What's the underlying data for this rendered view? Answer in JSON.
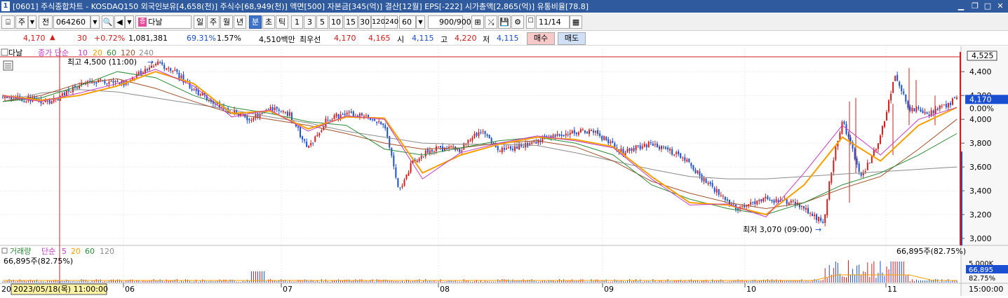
{
  "window": {
    "title_num": "1",
    "title": "[0601] 주식종합차트 - KOSDAQ150 외국인보유[4,658(천)] 주식수[68,949(천)] 액면[500] 자본금[345(억)] 결산[12월] EPS[-222] 시가총액[2,865(억)] 유통비율[78.8]"
  },
  "toolbar": {
    "market": "주",
    "prev_label": "전",
    "code": "064260",
    "badge": "증",
    "name": "다날",
    "periods": [
      "일",
      "주",
      "월",
      "년",
      "분",
      "초",
      "틱"
    ],
    "intervals": [
      "1",
      "3",
      "5",
      "10",
      "15",
      "30",
      "120",
      "240"
    ],
    "interval_value": "60",
    "count": "900",
    "count_total": "/900",
    "date": "11/14"
  },
  "quote": {
    "price": "4,170",
    "change": "30",
    "change_pct": "+0.72%",
    "volume": "1,081,381",
    "vol_ratio": "69.31%",
    "turnover": "1.57%",
    "amount": "4,510백만",
    "best_label": "최우선",
    "ask": "4,170",
    "bid": "4,165",
    "open_label": "시",
    "open": "4,115",
    "high_label": "고",
    "high": "4,220",
    "low_label": "저",
    "low": "4,115",
    "buy_label": "매수",
    "sell_label": "매도"
  },
  "price_panel": {
    "name": "다날",
    "ma_label": "종가 단순",
    "ma_periods": [
      "10",
      "20",
      "60",
      "120",
      "240"
    ],
    "high_annot": "최고 4,500 (11:00)",
    "low_annot": "최저 3,070 (09:00)"
  },
  "volume_panel": {
    "label": "거래량",
    "ma_label": "단순",
    "ma_periods": [
      "5",
      "20",
      "60",
      "120"
    ],
    "left_value": "66,895주(82.75%)",
    "right_value": "66,895주(82.75%)"
  },
  "axis": {
    "y_ticks": [
      "4,400",
      "4,200",
      "4,000",
      "3,800",
      "3,600",
      "3,400",
      "3,200",
      "3,000"
    ],
    "current_price": "4,170",
    "current_pct": "0.00%",
    "max_badge": "4,525",
    "vol_ticks": [
      "5,000K",
      "66,895",
      "82.75%"
    ],
    "x_labels": [
      "06",
      "07",
      "08",
      "09",
      "10",
      "11"
    ],
    "x_first": "202",
    "crosshair_date": "2023/05/18(목) 11:00:00",
    "time_label": "15:00:00"
  },
  "colors": {
    "up": "#d21d1d",
    "down": "#1a4fd1",
    "ma10": "#c43cc4",
    "ma20": "#f5a000",
    "ma60": "#2e8b3a",
    "ma120": "#a0522d",
    "ma240": "#8c8c8c"
  },
  "chart_data": {
    "type": "candlestick",
    "price_range": [
      3000,
      4525
    ],
    "ylim": [
      3000,
      4525
    ],
    "high": 4500,
    "low": 3070,
    "last_close": 4170,
    "month_labels": [
      "06",
      "07",
      "08",
      "09",
      "10",
      "11"
    ],
    "close_path": [
      [
        0,
        4180
      ],
      [
        0.03,
        4170
      ],
      [
        0.05,
        4140
      ],
      [
        0.07,
        4250
      ],
      [
        0.1,
        4330
      ],
      [
        0.13,
        4300
      ],
      [
        0.16,
        4480
      ],
      [
        0.18,
        4400
      ],
      [
        0.2,
        4250
      ],
      [
        0.23,
        4100
      ],
      [
        0.26,
        4000
      ],
      [
        0.28,
        4100
      ],
      [
        0.3,
        4050
      ],
      [
        0.32,
        3750
      ],
      [
        0.34,
        4000
      ],
      [
        0.36,
        4050
      ],
      [
        0.38,
        4040
      ],
      [
        0.4,
        3950
      ],
      [
        0.415,
        3400
      ],
      [
        0.43,
        3650
      ],
      [
        0.45,
        3750
      ],
      [
        0.48,
        3750
      ],
      [
        0.5,
        3900
      ],
      [
        0.52,
        3750
      ],
      [
        0.55,
        3780
      ],
      [
        0.58,
        3880
      ],
      [
        0.62,
        3900
      ],
      [
        0.65,
        3720
      ],
      [
        0.68,
        3800
      ],
      [
        0.71,
        3700
      ],
      [
        0.74,
        3450
      ],
      [
        0.77,
        3250
      ],
      [
        0.8,
        3330
      ],
      [
        0.83,
        3300
      ],
      [
        0.85,
        3200
      ],
      [
        0.86,
        3120
      ],
      [
        0.87,
        3650
      ],
      [
        0.88,
        4000
      ],
      [
        0.89,
        3750
      ],
      [
        0.9,
        3500
      ],
      [
        0.92,
        3850
      ],
      [
        0.935,
        4350
      ],
      [
        0.95,
        4100
      ],
      [
        0.97,
        4050
      ],
      [
        1.0,
        4170
      ]
    ],
    "ma10": [
      4200,
      4150,
      4220,
      4300,
      4420,
      4280,
      4020,
      4080,
      3900,
      4030,
      4000,
      3500,
      3720,
      3800,
      3860,
      3820,
      3760,
      3500,
      3280,
      3290,
      3180,
      3550,
      3950,
      3700,
      4000,
      4100
    ],
    "ma20": [
      4200,
      4160,
      4200,
      4280,
      4400,
      4300,
      4050,
      4070,
      3920,
      4020,
      4010,
      3550,
      3700,
      3790,
      3850,
      3830,
      3770,
      3520,
      3300,
      3280,
      3200,
      3450,
      3850,
      3650,
      3950,
      4100
    ],
    "ma60": [
      4150,
      4180,
      4280,
      4400,
      4350,
      4200,
      4100,
      4050,
      3980,
      3950,
      3750,
      3700,
      3760,
      3820,
      3850,
      3800,
      3700,
      3450,
      3330,
      3250,
      3200,
      3300,
      3450,
      3550,
      3700,
      3880
    ],
    "ma120": [
      4150,
      4200,
      4300,
      4340,
      4260,
      4150,
      4050,
      4000,
      3950,
      3880,
      3800,
      3750,
      3760,
      3800,
      3820,
      3770,
      3650,
      3480,
      3380,
      3300,
      3250,
      3300,
      3420,
      3520,
      3750,
      4000
    ],
    "ma240": [
      4150,
      4220,
      4250,
      4230,
      4180,
      4130,
      4080,
      4020,
      3970,
      3900,
      3850,
      3800,
      3790,
      3790,
      3780,
      3720,
      3650,
      3580,
      3520,
      3500,
      3500,
      3520,
      3540,
      3560,
      3580,
      3600
    ]
  }
}
